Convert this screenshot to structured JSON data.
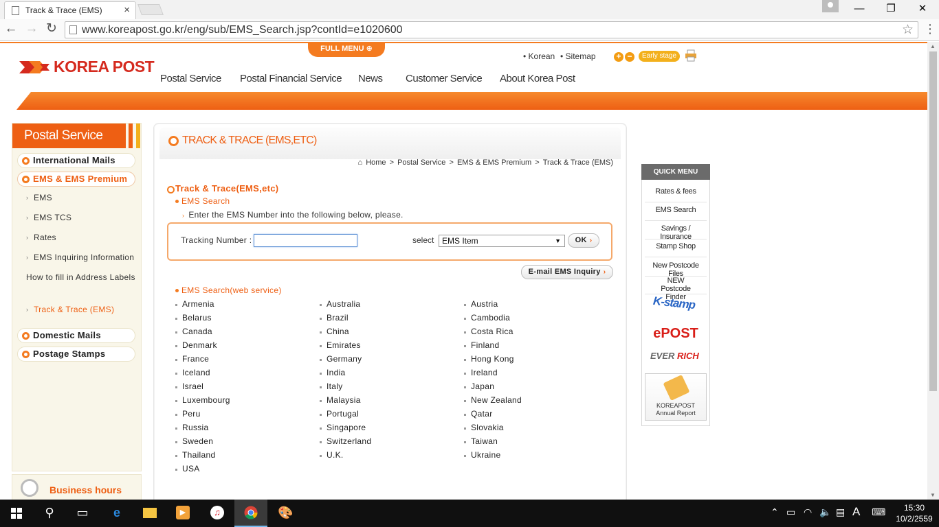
{
  "browser": {
    "tab_title": "Track & Trace (EMS)",
    "tab_close": "×",
    "url": "www.koreapost.go.kr/eng/sub/EMS_Search.jsp?contId=e1020600",
    "window_buttons": {
      "minimize": "—",
      "restore": "❐",
      "close": "✕"
    },
    "nav": {
      "back": "←",
      "forward": "→",
      "reload": "↻",
      "star": "☆",
      "menu": "⋮"
    }
  },
  "header": {
    "logo_text": "KOREA POST",
    "full_menu": "FULL MENU",
    "util_links": [
      "• Korean",
      "• Sitemap"
    ],
    "font_plus": "+",
    "font_minus": "−",
    "early_stage": "Early stage",
    "gnb": [
      "Postal Service",
      "Postal Financial Service",
      "News",
      "Customer Service",
      "About Korea Post"
    ],
    "colors": {
      "accent": "#ee5f13",
      "brand_red": "#d52a1e"
    }
  },
  "sidebar": {
    "title": "Postal Service",
    "items": [
      {
        "label": "International Mails"
      },
      {
        "label": "EMS & EMS Premium"
      },
      {
        "label": "Domestic Mails"
      },
      {
        "label": "Postage Stamps"
      }
    ],
    "sub_items": [
      {
        "label": "EMS"
      },
      {
        "label": "EMS TCS"
      },
      {
        "label": "Rates"
      },
      {
        "label": "EMS Inquiring Information"
      },
      {
        "label": "How to fill in Address Labels"
      },
      {
        "label": "Track & Trace (EMS)"
      }
    ],
    "business_hours": "Business hours"
  },
  "content": {
    "title": "TRACK & TRACE (EMS,ETC)",
    "breadcrumb": [
      "Home",
      "Postal Service",
      "EMS & EMS Premium",
      "Track & Trace (EMS)"
    ],
    "breadcrumb_sep": ">",
    "section_title": "Track & Trace(EMS,etc)",
    "ems_search": "EMS Search",
    "instruction": "Enter the EMS Number into the following below, please.",
    "tracking_label": "Tracking Number :",
    "tracking_value": "",
    "select_label": "select",
    "select_value": "EMS Item",
    "ok_button": "OK",
    "email_button": "E-mail EMS Inquiry",
    "web_service_title": "EMS Search(web service)",
    "countries": [
      [
        "Armenia",
        "Australia",
        "Austria"
      ],
      [
        "Belarus",
        "Brazil",
        "Cambodia"
      ],
      [
        "Canada",
        "China",
        "Costa Rica"
      ],
      [
        "Denmark",
        "Emirates",
        "Finland"
      ],
      [
        "France",
        "Germany",
        "Hong Kong"
      ],
      [
        "Iceland",
        "India",
        "Ireland"
      ],
      [
        "Israel",
        "Italy",
        "Japan"
      ],
      [
        "Luxembourg",
        "Malaysia",
        "New Zealand"
      ],
      [
        "Peru",
        "Portugal",
        "Qatar"
      ],
      [
        "Russia",
        "Singapore",
        "Slovakia"
      ],
      [
        "Sweden",
        "Switzerland",
        "Taiwan"
      ],
      [
        "Thailand",
        "U.K.",
        "Ukraine"
      ],
      [
        "USA"
      ]
    ]
  },
  "quick_menu": {
    "title": "QUICK MENU",
    "items": [
      "Rates & fees",
      "EMS Search",
      "Savings / Insurance",
      "Stamp Shop",
      "New Postcode Files",
      "NEW Postcode Finder"
    ],
    "kstamp": "K-stamp",
    "epost": "ePOST",
    "everrich_ever": "EVER",
    "everrich_rich": "RICH",
    "annual_1": "KOREAPOST",
    "annual_2": "Annual Report"
  },
  "taskbar": {
    "time": "15:30",
    "date": "10/2/2559",
    "ime": "A"
  }
}
